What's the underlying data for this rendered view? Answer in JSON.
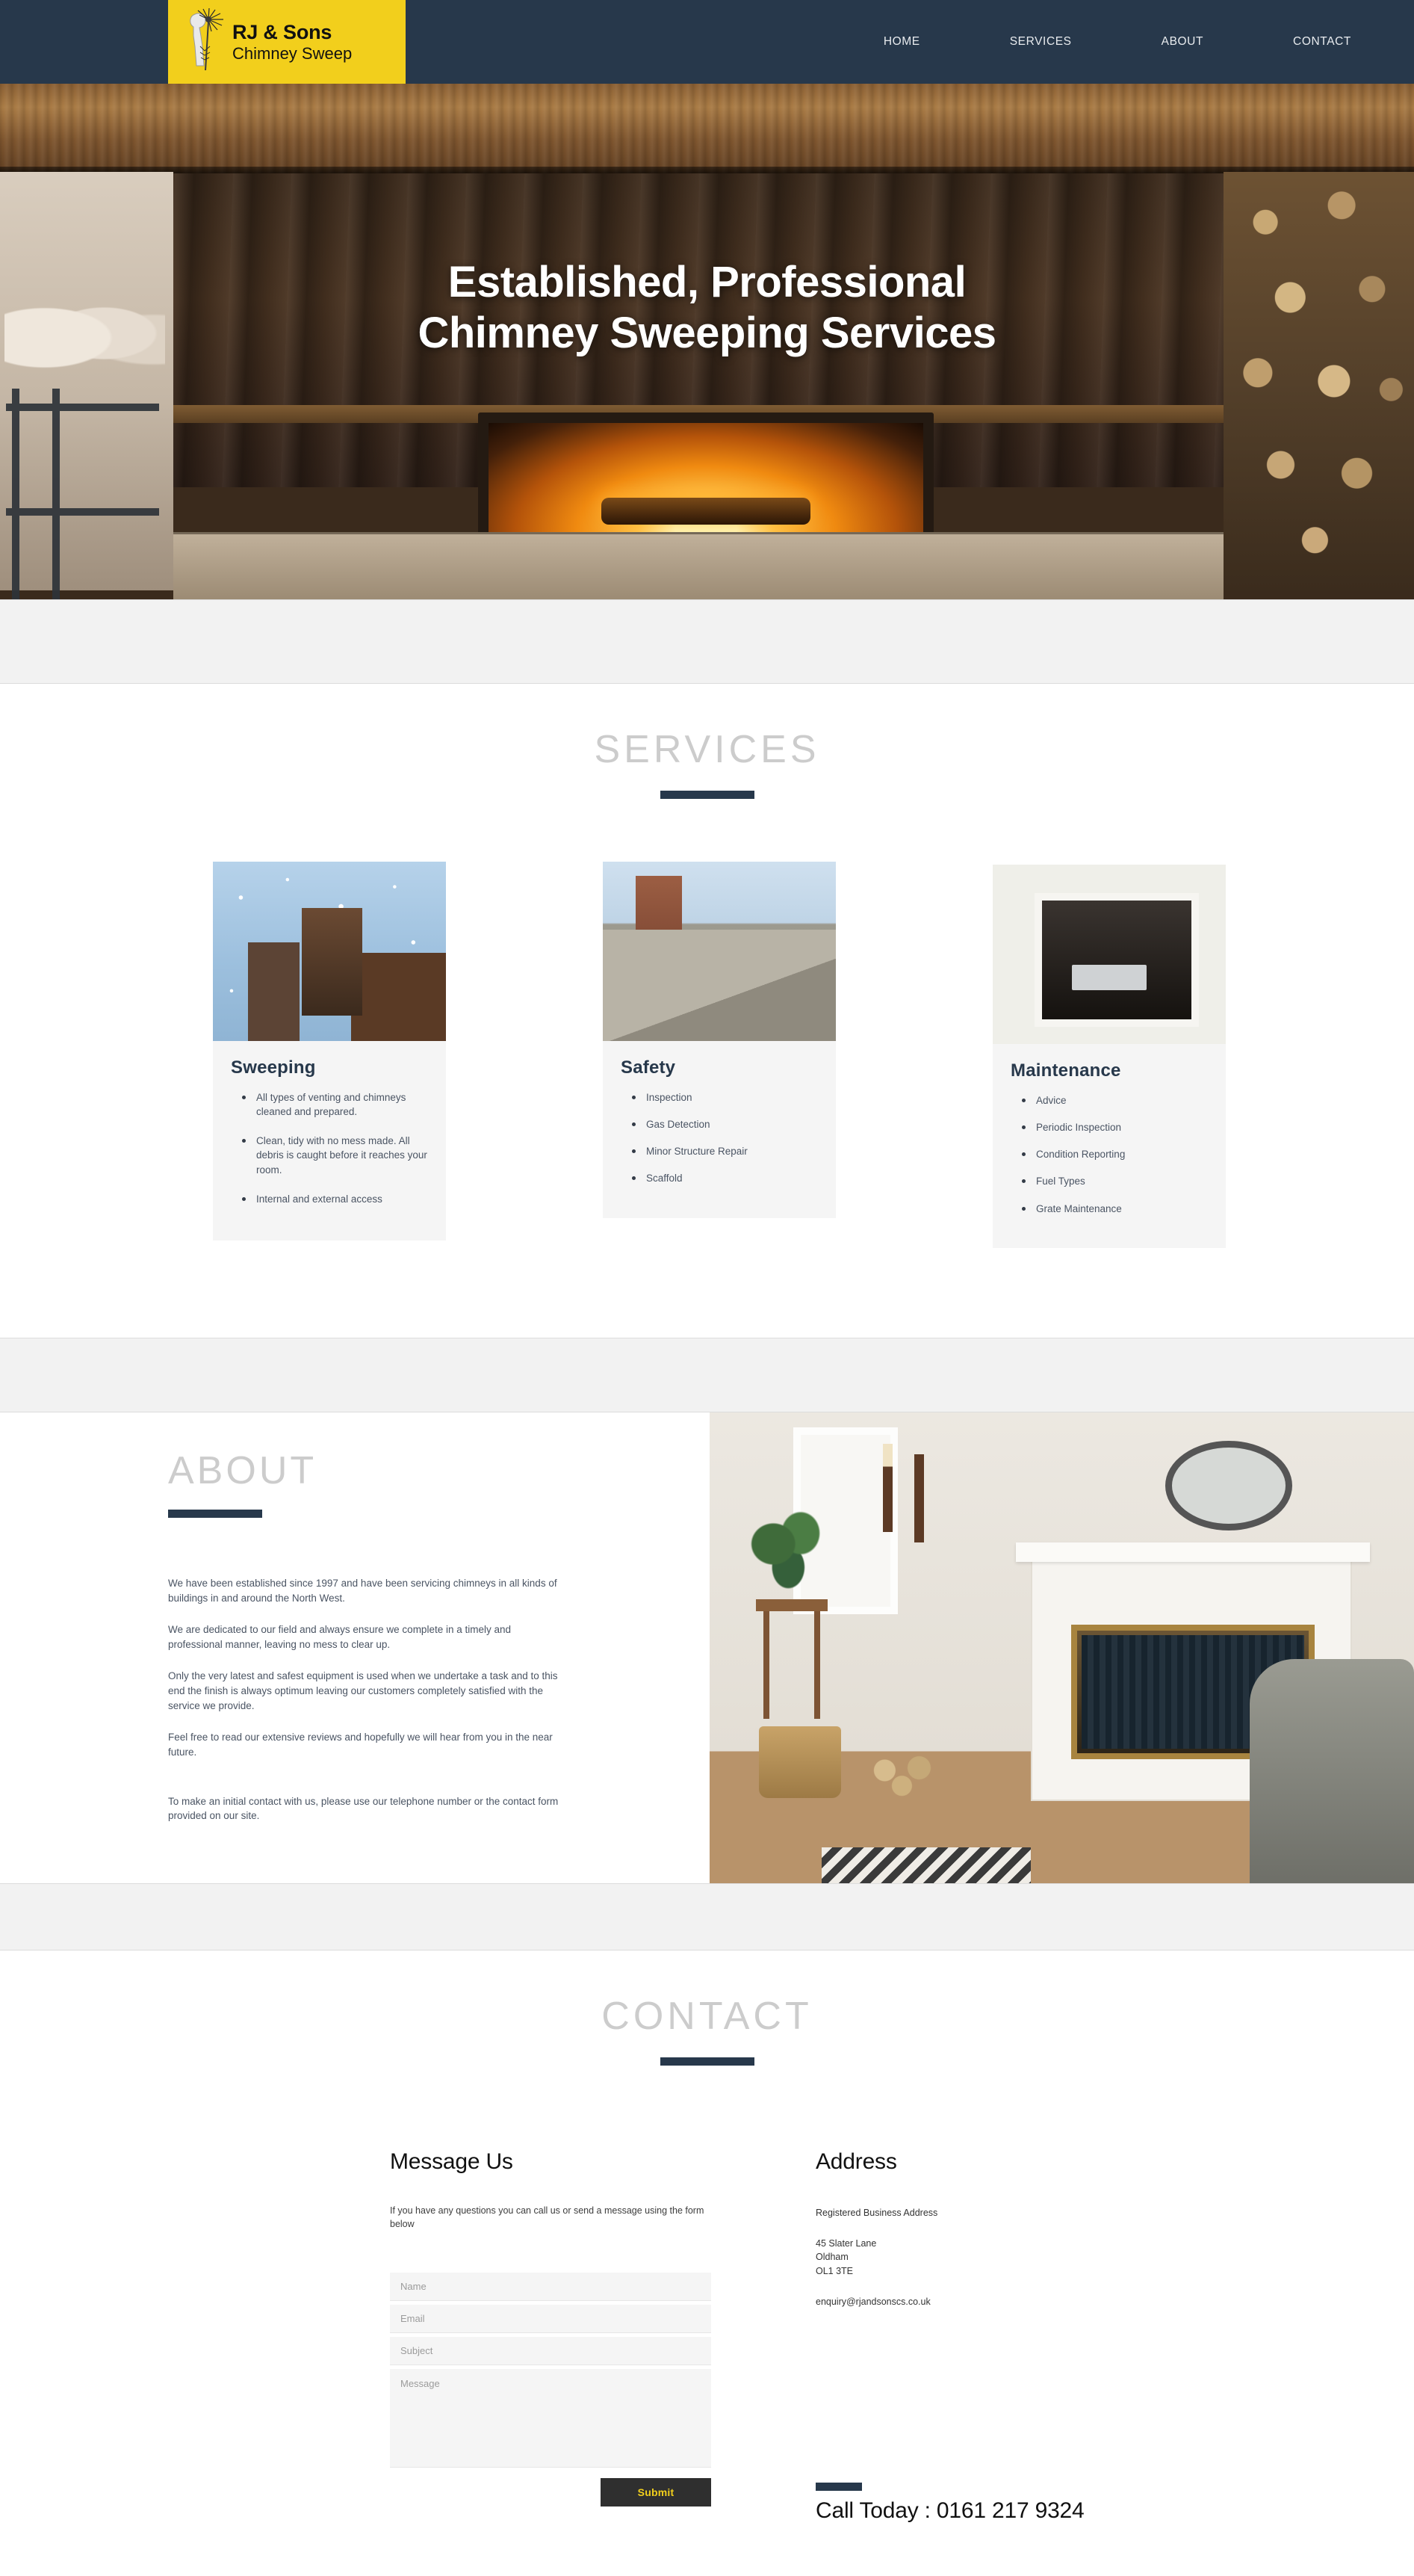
{
  "header": {
    "logo": {
      "icon": "chimney-sweep-brush-icon",
      "title": "RJ & Sons",
      "subtitle": "Chimney Sweep",
      "bg_color": "#f2cf1c"
    },
    "nav": [
      {
        "label": "HOME"
      },
      {
        "label": "SERVICES"
      },
      {
        "label": "ABOUT"
      },
      {
        "label": "CONTACT"
      }
    ],
    "bg_color": "#27384b"
  },
  "hero": {
    "title_line_1": "Established, Professional",
    "title_line_2": "Chimney Sweeping Services",
    "image_alt": "wood-burning-fireplace-photo"
  },
  "services": {
    "heading": "SERVICES",
    "cards": [
      {
        "title": "Sweeping",
        "image_alt": "snowy-chimney-stacks-photo",
        "items": [
          "All types of venting and chimneys cleaned and prepared.",
          "Clean, tidy with no mess made. All debris is caught before it reaches your room.",
          "Internal and external access"
        ]
      },
      {
        "title": "Safety",
        "image_alt": "roof-and-chimney-photo",
        "items": [
          "Inspection",
          "Gas Detection",
          "Minor Structure Repair",
          "Scaffold"
        ]
      },
      {
        "title": "Maintenance",
        "image_alt": "white-brick-fireplace-photo",
        "items": [
          "Advice",
          "Periodic Inspection",
          "Condition Reporting",
          "Fuel Types",
          "Grate Maintenance"
        ]
      }
    ]
  },
  "about": {
    "heading": "ABOUT",
    "image_alt": "living-room-with-white-fireplace-photo",
    "paragraphs": [
      "We have been established since 1997 and have been servicing chimneys in all kinds of buildings in and around the North West.",
      "We are dedicated to our field and always ensure we complete in a timely and professional manner, leaving no mess to clear up.",
      "Only the very latest and safest equipment is used when we undertake a task and to this end the finish is always optimum leaving our customers completely satisfied with the service we provide.",
      "Feel free to read our extensive reviews and hopefully we will hear from you in the near future.",
      "To make an initial contact with us, please use our telephone number or the contact form provided on our site."
    ]
  },
  "contact": {
    "heading": "CONTACT",
    "message": {
      "title": "Message Us",
      "note": "If you have any questions you can call us or send a message using the form below",
      "fields": {
        "name_placeholder": "Name",
        "email_placeholder": "Email",
        "subject_placeholder": "Subject",
        "message_placeholder": "Message"
      },
      "submit_label": "Submit",
      "submit_bg": "#2f2f2f",
      "submit_color": "#f2cf1c"
    },
    "address": {
      "title": "Address",
      "lead": "Registered Business Address",
      "line1": "45 Slater Lane",
      "line2": "Oldham",
      "line3": "OL1 3TE",
      "email": "enquiry@rjandsonscs.co.uk"
    },
    "call": {
      "text": "Call Today :  0161 217 9324"
    }
  },
  "theme": {
    "navy": "#27384b",
    "yellow": "#f2cf1c",
    "band_gray": "#f2f2f2",
    "heading_gray": "#cccccc",
    "card_bg": "#f5f5f5"
  }
}
